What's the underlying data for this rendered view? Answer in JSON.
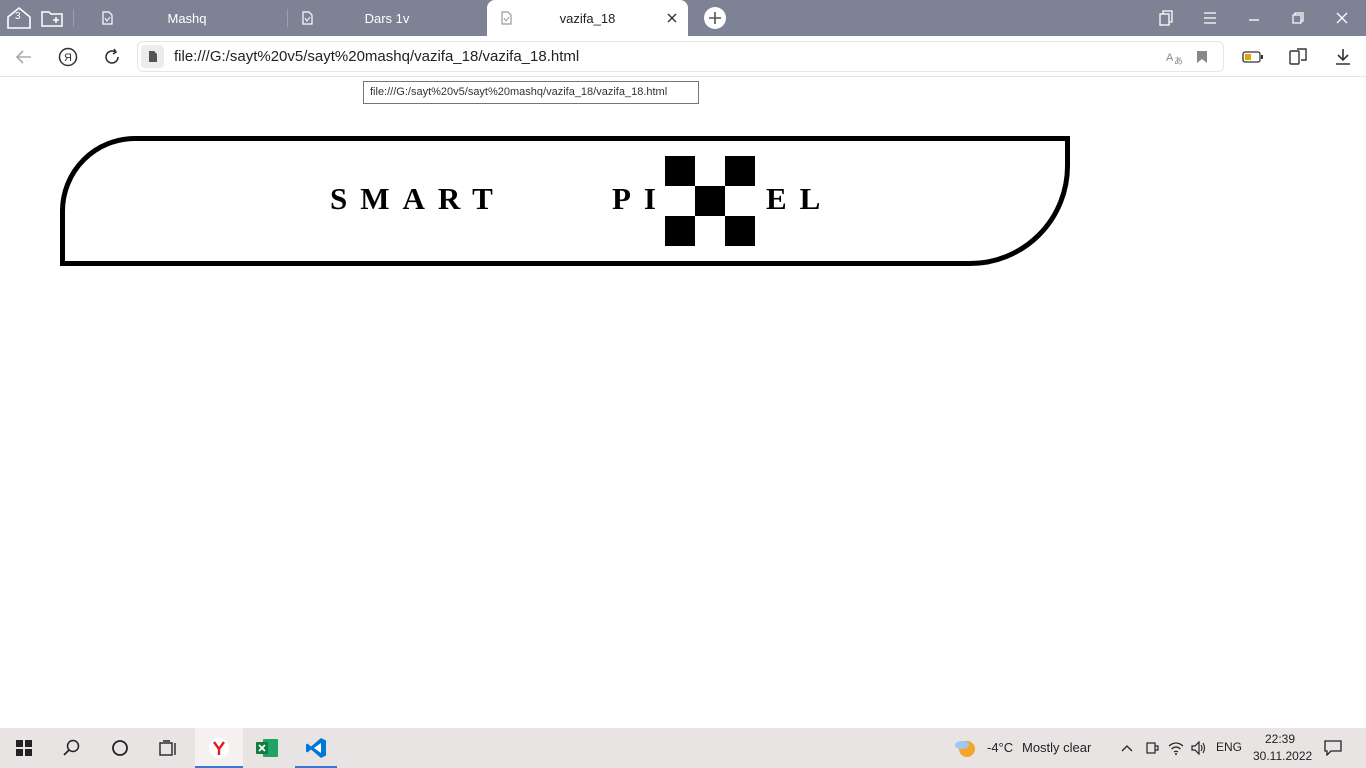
{
  "browser": {
    "tab_counter": "3",
    "tabs": [
      {
        "title": "Mashq"
      },
      {
        "title": "Dars 1v"
      },
      {
        "title": "vazifa_18"
      }
    ],
    "address": "file:///G:/sayt%20v5/sayt%20mashq/vazifa_18/vazifa_18.html",
    "tooltip": "file:///G:/sayt%20v5/sayt%20mashq/vazifa_18/vazifa_18.html"
  },
  "page": {
    "logo_word1": "SMART",
    "logo_word2_start": "PI",
    "logo_word2_end": "EL"
  },
  "taskbar": {
    "weather_temp": "-4°C",
    "weather_text": "Mostly clear",
    "language": "ENG",
    "time": "22:39",
    "date": "30.11.2022"
  }
}
